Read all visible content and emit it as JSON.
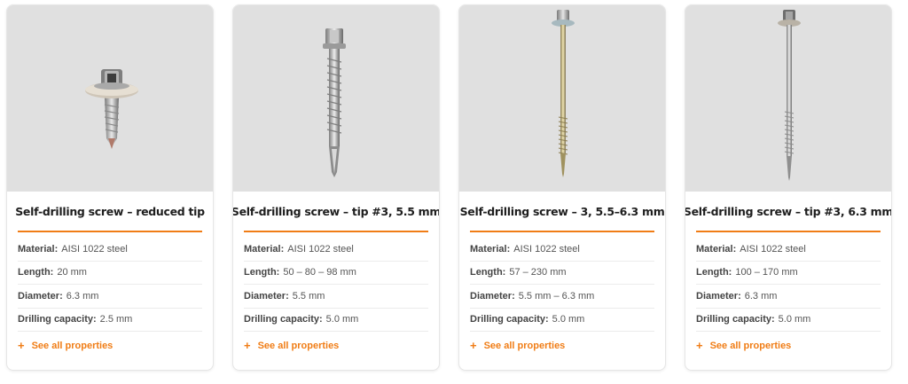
{
  "accent_color": "#f07d16",
  "products": [
    {
      "title": "Self-drilling screw – reduced tip",
      "image_icon": "short-screw-with-washer-icon",
      "props": [
        {
          "key": "Material:",
          "value": "AISI 1022 steel"
        },
        {
          "key": "Length:",
          "value": "20 mm"
        },
        {
          "key": "Diameter:",
          "value": "6.3 mm"
        },
        {
          "key": "Drilling capacity:",
          "value": "2.5 mm"
        }
      ],
      "link": "See all properties"
    },
    {
      "title": "Self-drilling screw – tip #3, 5.5 mm",
      "image_icon": "hex-head-screw-icon",
      "props": [
        {
          "key": "Material:",
          "value": "AISI 1022 steel"
        },
        {
          "key": "Length:",
          "value": "50 – 80 – 98 mm"
        },
        {
          "key": "Diameter:",
          "value": "5.5 mm"
        },
        {
          "key": "Drilling capacity:",
          "value": "5.0 mm"
        }
      ],
      "link": "See all properties"
    },
    {
      "title": "Self-drilling screw – 3, 5.5–6.3 mm",
      "image_icon": "long-screw-with-washer-icon",
      "props": [
        {
          "key": "Material:",
          "value": "AISI 1022 steel"
        },
        {
          "key": "Length:",
          "value": "57 – 230 mm"
        },
        {
          "key": "Diameter:",
          "value": "5.5 mm – 6.3 mm"
        },
        {
          "key": "Drilling capacity:",
          "value": "5.0 mm"
        }
      ],
      "link": "See all properties"
    },
    {
      "title": "Self-drilling screw – tip #3, 6.3 mm",
      "image_icon": "long-screw-with-washer-icon",
      "props": [
        {
          "key": "Material:",
          "value": "AISI 1022 steel"
        },
        {
          "key": "Length:",
          "value": "100 – 170 mm"
        },
        {
          "key": "Diameter:",
          "value": "6.3 mm"
        },
        {
          "key": "Drilling capacity:",
          "value": "5.0 mm"
        }
      ],
      "link": "See all properties"
    }
  ]
}
